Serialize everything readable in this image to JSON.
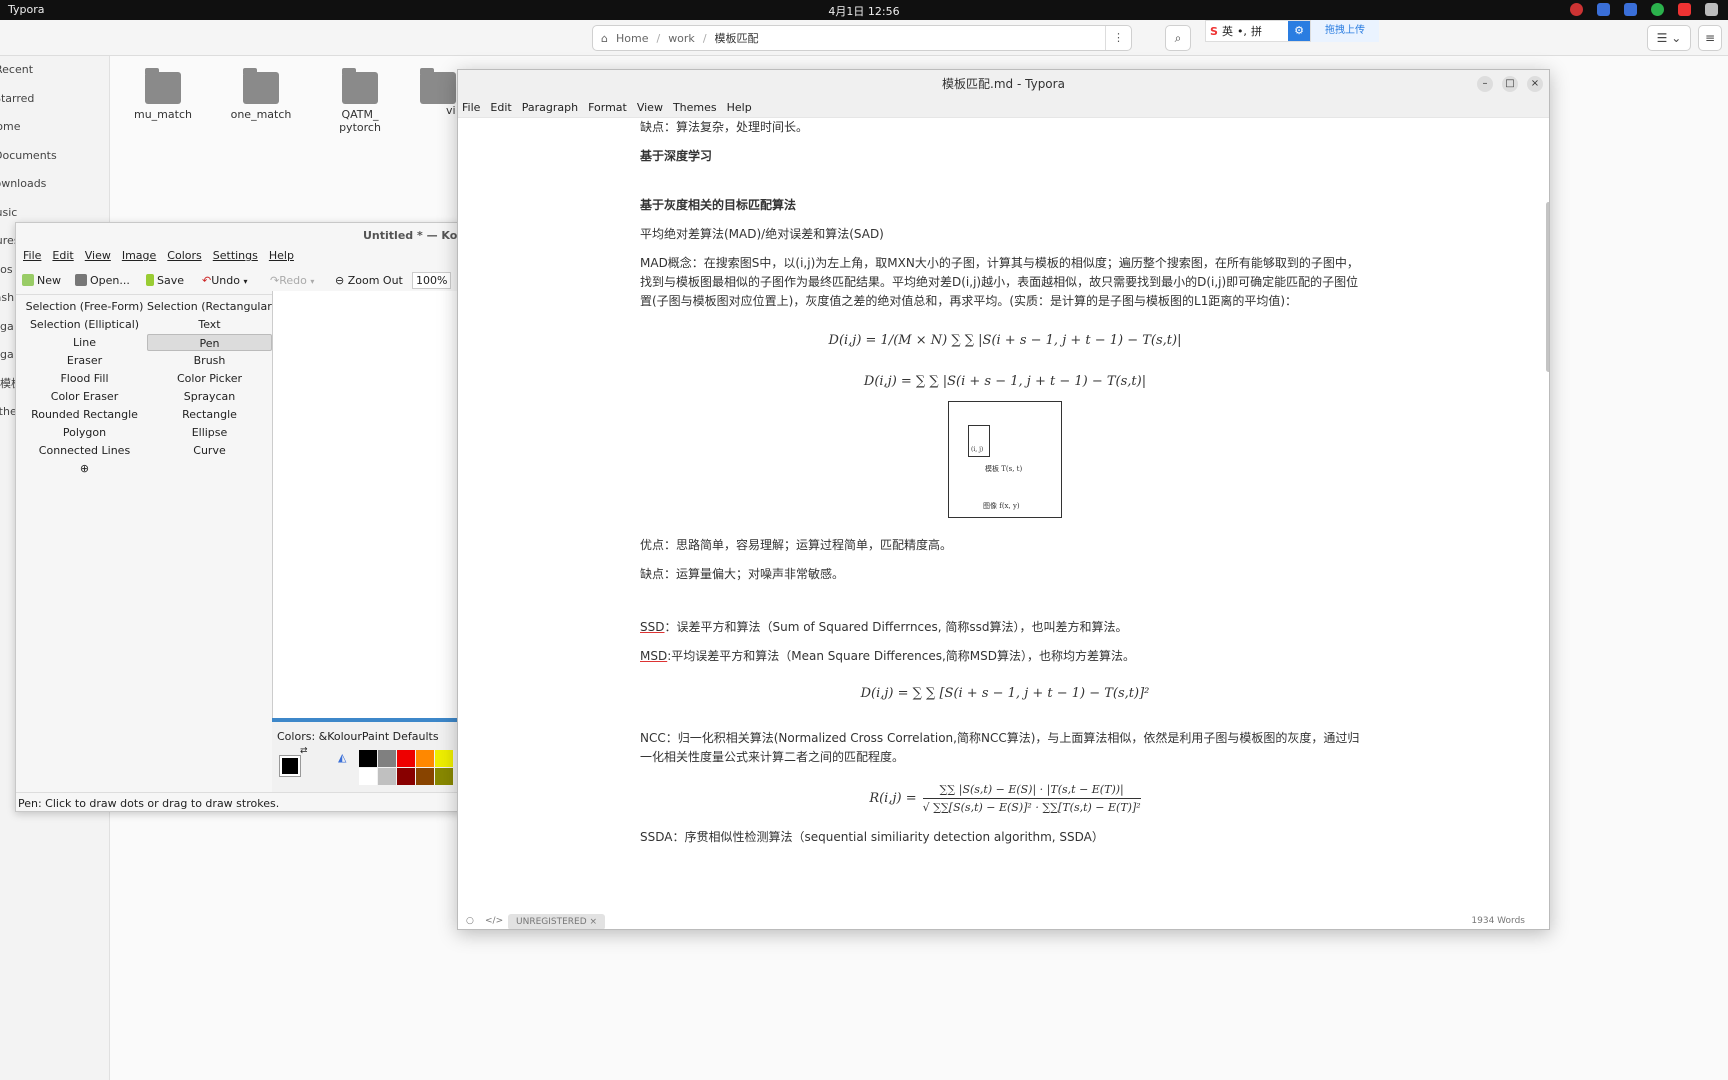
{
  "topbar": {
    "app": "Typora",
    "clock": "4月1日 12:56"
  },
  "files": {
    "breadcrumb": [
      "Home",
      "work",
      "模板匹配"
    ],
    "sidebar": [
      "Recent",
      "Starred",
      "Home",
      "Documents",
      "Downloads",
      "Music",
      "Pictures",
      "Videos",
      "Trash",
      "ga",
      "ga",
      "模板",
      "Other"
    ],
    "folders": [
      "mu_match",
      "one_match",
      "QATM_ pytorch",
      "vi"
    ]
  },
  "ime": {
    "s": "S",
    "lang": "英",
    "mode": "拼",
    "upload": "拖拽上传"
  },
  "kolourpaint": {
    "title": "Untitled * — KolourPaint",
    "menu": [
      "File",
      "Edit",
      "View",
      "Image",
      "Colors",
      "Settings",
      "Help"
    ],
    "toolbar": {
      "new": "New",
      "open": "Open...",
      "save": "Save",
      "undo": "Undo",
      "redo": "Redo",
      "zoom_out": "Zoom Out",
      "zoom": "100%"
    },
    "tools": [
      "Selection (Free-Form)",
      "Selection (Rectangular)",
      "Selection (Elliptical)",
      "Text",
      "Line",
      "Pen",
      "Eraser",
      "Brush",
      "Flood Fill",
      "Color Picker",
      "Color Eraser",
      "Spraycan",
      "Rounded Rectangle",
      "Rectangle",
      "Polygon",
      "Ellipse",
      "Connected Lines",
      "Curve"
    ],
    "selected_tool": "Pen",
    "colors_label": "Colors: &KolourPaint Defaults",
    "status": "Pen: Click to draw dots or drag to draw strokes."
  },
  "typora": {
    "title": "模板匹配.md - Typora",
    "menu": [
      "File",
      "Edit",
      "Paragraph",
      "Format",
      "View",
      "Themes",
      "Help"
    ],
    "doc": {
      "p1": "缺点：算法复杂，处理时间长。",
      "h1": "基于深度学习",
      "h2": "基于灰度相关的目标匹配算法",
      "p2": "平均绝对差算法(MAD)/绝对误差和算法(SAD)",
      "p3": "MAD概念：在搜索图S中，以(i,j)为左上角，取MXN大小的子图，计算其与模板的相似度；遍历整个搜索图，在所有能够取到的子图中，找到与模板图最相似的子图作为最终匹配结果。平均绝对差D(i,j)越小，表面越相似，故只需要找到最小的D(i,j)即可确定能匹配的子图位置(子图与模板图对应位置上)，灰度值之差的绝对值总和，再求平均。(实质：是计算的是子图与模板图的L1距离的平均值)：",
      "f1": "D(i,j) = 1/(M × N) ∑ ∑ |S(i + s − 1, j + t − 1) − T(s,t)|",
      "f2": "D(i,j) = ∑ ∑ |S(i + s − 1, j + t − 1) − T(s,t)|",
      "fig_sub": "(i, j)",
      "fig_tmpl": "模板 T(s, t)",
      "fig_img": "图像 f(x, y)",
      "p4": "优点：思路简单，容易理解；运算过程简单，匹配精度高。",
      "p5": "缺点：运算量偏大；对噪声非常敏感。",
      "p6a": "SSD",
      "p6b": "：误差平方和算法（Sum of Squared Differrnces, 简称ssd算法），也叫差方和算法。",
      "p7a": "MSD",
      "p7b": ":平均误差平方和算法（Mean Square Differences,简称MSD算法），也称均方差算法。",
      "f3": "D(i,j) = ∑ ∑ [S(i + s − 1, j + t − 1) − T(s,t)]²",
      "p8": "NCC：归一化积相关算法(Normalized Cross Correlation,简称NCC算法)，与上面算法相似，依然是利用子图与模板图的灰度，通过归一化相关性度量公式来计算二者之间的匹配程度。",
      "f4_lhs": "R(i,j) =",
      "f4_num": "∑∑ |S(s,t) − E(S)| · |T(s,t − E(T))|",
      "f4_den": "√ ∑∑[S(s,t) − E(S)]² · ∑∑[T(s,t) − E(T)]²",
      "p9": "SSDA：序贯相似性检测算法（sequential similiarity detection algorithm, SSDA）"
    },
    "footer": {
      "badge": "UNREGISTERED ×",
      "words": "1934 Words"
    }
  },
  "colors": {
    "accent": "#3d87c9",
    "ime_red": "#e33333"
  }
}
